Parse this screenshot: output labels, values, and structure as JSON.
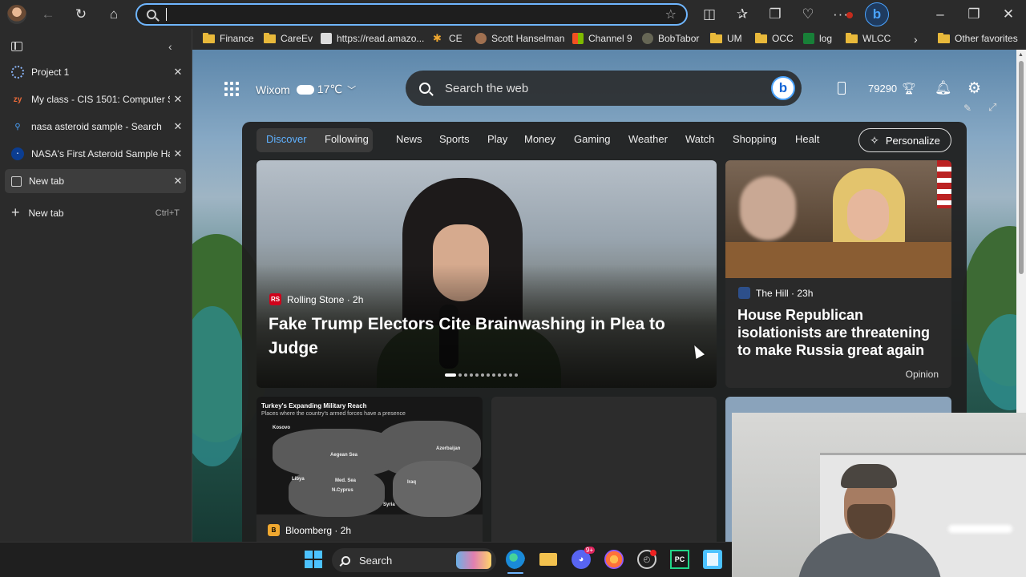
{
  "browser": {
    "address_placeholder": "",
    "favorites_bar": [
      {
        "label": "Finance",
        "icon": "folder-icon"
      },
      {
        "label": "CareEv",
        "icon": "folder-icon"
      },
      {
        "label": "https://read.amazo...",
        "icon": "kindle-icon"
      },
      {
        "label": "CE",
        "icon": "gear-icon"
      },
      {
        "label": "Scott Hanselman",
        "icon": "avatar-icon"
      },
      {
        "label": "Channel 9",
        "icon": "windows-icon"
      },
      {
        "label": "BobTabor",
        "icon": "avatar-icon"
      },
      {
        "label": "UM",
        "icon": "folder-icon"
      },
      {
        "label": "OCC",
        "icon": "folder-icon"
      },
      {
        "label": "log",
        "icon": "sheets-icon"
      },
      {
        "label": "WLCC",
        "icon": "folder-icon"
      },
      {
        "label": "Other favorites",
        "icon": "folder-icon"
      }
    ],
    "tabs": [
      {
        "label": "Project 1",
        "icon": "loading-icon"
      },
      {
        "label": "My class - CIS 1501: Computer Sc",
        "icon": "zybooks-icon"
      },
      {
        "label": "nasa asteroid sample - Search",
        "icon": "search-icon"
      },
      {
        "label": "NASA's First Asteroid Sample Ha",
        "icon": "nasa-icon"
      },
      {
        "label": "New tab",
        "icon": "newtab-icon",
        "active": true
      }
    ],
    "new_tab_label": "New tab",
    "new_tab_shortcut": "Ctrl+T"
  },
  "ntp": {
    "location": "Wixom",
    "temperature": "17℃",
    "search_placeholder": "Search the web",
    "points": "79290",
    "nav": [
      "Discover",
      "Following",
      "News",
      "Sports",
      "Play",
      "Money",
      "Gaming",
      "Weather",
      "Watch",
      "Shopping",
      "Healt"
    ],
    "personalize_label": "Personalize",
    "hero": {
      "source": "Rolling Stone · 2h",
      "source_logo": "RS",
      "headline": "Fake Trump Electors Cite Brainwashing in Plea to Judge"
    },
    "card2": {
      "source": "The Hill · 23h",
      "headline": "House Republican isolationists are threatening to make Russia great again",
      "tag": "Opinion"
    },
    "card3": {
      "source": "Bloomberg · 2h",
      "source_logo": "B",
      "map_title": "Turkey's Expanding Military Reach",
      "map_subtitle": "Places where the country's armed forces have a presence",
      "map_labels": [
        "Kosovo",
        "Aegean Sea",
        "Azerbaijan",
        "Libya",
        "Med. Sea",
        "N.Cyprus",
        "Iraq",
        "Syria"
      ]
    }
  },
  "taskbar": {
    "search_label": "Search",
    "discord_badge": "9+"
  },
  "colors": {
    "accent": "#5fb1ff",
    "address_border": "#6fb6ff"
  }
}
